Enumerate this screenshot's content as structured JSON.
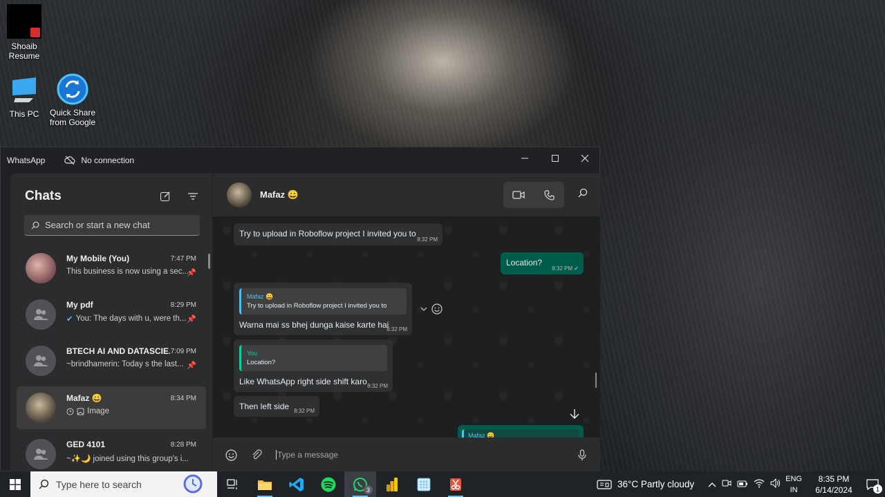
{
  "desktop": {
    "icons": [
      {
        "label_line1": "Shoaib",
        "label_line2": "Resume"
      },
      {
        "label_line1": "This PC",
        "label_line2": ""
      },
      {
        "label_line1": "Quick Share",
        "label_line2": "from Google"
      }
    ]
  },
  "window": {
    "title": "WhatsApp",
    "connection_status": "No connection"
  },
  "sidebar": {
    "title": "Chats",
    "search_placeholder": "Search or start a new chat",
    "chats": [
      {
        "name": "My Mobile (You)",
        "time": "7:47 PM",
        "preview": "This business is now using a sec...",
        "pinned": true
      },
      {
        "name": "My pdf",
        "time": "8:29 PM",
        "preview": "You: The days with u, were th...",
        "pinned": true
      },
      {
        "name": "BTECH AI AND DATASCIE...",
        "time": "7:09 PM",
        "preview": "~brindhamerin: Today s the last...",
        "pinned": true
      },
      {
        "name": "Mafaz 😀",
        "time": "8:34 PM",
        "preview": "Image",
        "pinned": false
      },
      {
        "name": "GED 4101",
        "time": "8:28 PM",
        "preview": "~✨🌙 joined using this group's i...",
        "pinned": false
      }
    ]
  },
  "conversation": {
    "contact_name": "Mafaz 😀",
    "messages": [
      {
        "text": "Try to upload in Roboflow project I invited you to",
        "time": "8:32 PM"
      },
      {
        "text": "Location?",
        "time": "8:32 PM"
      },
      {
        "quote_name": "Mafaz 😀",
        "quote_text": "Try to upload in Roboflow project I invited you to",
        "text": "Warna mai ss bhej dunga kaise karte hai",
        "time": "8:32 PM"
      },
      {
        "quote_name": "You",
        "quote_text": "Location?",
        "text": "Like WhatsApp right side shift karo",
        "time": "8:32 PM"
      },
      {
        "text": "Then left side",
        "time": "8:32 PM"
      },
      {
        "quote_name": "Mafaz 😀"
      }
    ],
    "composer_placeholder": "Type a message"
  },
  "taskbar": {
    "search_placeholder": "Type here to search",
    "whatsapp_badge": "3",
    "weather": "36°C  Partly cloudy",
    "lang_line1": "ENG",
    "lang_line2": "IN",
    "time": "8:35 PM",
    "date": "6/14/2024",
    "notification_count": "1"
  },
  "colors": {
    "outgoing_bubble": "#005c4b",
    "incoming_bubble": "#2f3032",
    "accent": "#06cf9c"
  }
}
